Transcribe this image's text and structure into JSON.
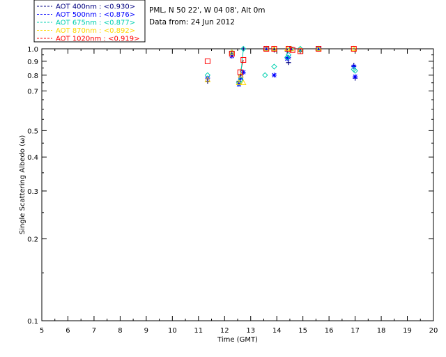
{
  "header": {
    "site": "PML, N 50 22', W 04 08', Alt 0m",
    "date_line": "Data from: 24 Jun 2012"
  },
  "chart_data": {
    "type": "scatter",
    "xlabel": "Time (GMT)",
    "ylabel": "Single Scattering Albedo (ω)",
    "xlim": [
      5,
      20
    ],
    "ylim": [
      0.1,
      1.0
    ],
    "yscale": "log",
    "xticks": [
      "5",
      "6",
      "7",
      "8",
      "9",
      "10",
      "11",
      "12",
      "13",
      "14",
      "15",
      "16",
      "17",
      "18",
      "19",
      "20"
    ],
    "yticks": [
      {
        "value": 1.0,
        "label": "1.0"
      },
      {
        "value": 0.9,
        "label": "0.9"
      },
      {
        "value": 0.8,
        "label": "0.8"
      },
      {
        "value": 0.7,
        "label": "0.7"
      },
      {
        "value": 0.5,
        "label": "0.5"
      },
      {
        "value": 0.4,
        "label": "0.4"
      },
      {
        "value": 0.3,
        "label": "0.3"
      },
      {
        "value": 0.2,
        "label": "0.2"
      },
      {
        "value": 0.1,
        "label": "0.1"
      }
    ],
    "legend_placement": "top-left",
    "series": [
      {
        "name": "AOT  400nm : <0.930>",
        "color": "#000080",
        "marker": "plus",
        "x": [
          11.35,
          12.28,
          12.55,
          12.62,
          12.72,
          13.6,
          13.9,
          14.4,
          14.45,
          14.55,
          14.9,
          15.6,
          16.95,
          17.0
        ],
        "y": [
          0.76,
          0.96,
          0.76,
          0.8,
          1.0,
          1.0,
          0.99,
          0.98,
          0.89,
          1.0,
          0.98,
          1.0,
          0.87,
          0.78
        ]
      },
      {
        "name": "AOT  500nm : <0.876>",
        "color": "#0000ff",
        "marker": "star",
        "x": [
          11.35,
          12.28,
          12.55,
          12.62,
          12.72,
          13.6,
          13.9,
          14.4,
          14.45,
          14.55,
          14.9,
          15.6,
          16.95,
          17.0
        ],
        "y": [
          0.78,
          0.94,
          0.74,
          0.78,
          0.82,
          1.0,
          0.8,
          0.92,
          0.93,
          1.0,
          0.99,
          1.0,
          0.86,
          0.79
        ]
      },
      {
        "name": "AOT  675nm : <0.877>",
        "color": "#00d0b0",
        "marker": "diamond",
        "x": [
          11.35,
          12.28,
          12.55,
          12.62,
          12.72,
          13.55,
          13.9,
          14.4,
          14.45,
          14.55,
          14.9,
          15.6,
          16.95,
          17.0
        ],
        "y": [
          0.8,
          0.97,
          0.75,
          0.77,
          1.0,
          0.8,
          0.86,
          0.93,
          0.95,
          1.0,
          1.0,
          1.0,
          0.84,
          0.83
        ]
      },
      {
        "name": "AOT  870nm : <0.892>",
        "color": "#ffd700",
        "marker": "triangle",
        "x": [
          11.35,
          12.28,
          12.55,
          12.62,
          12.72,
          13.6,
          13.9,
          14.4,
          14.55,
          14.9,
          15.6,
          16.95
        ],
        "y": [
          0.77,
          0.97,
          0.75,
          0.8,
          0.75,
          1.0,
          1.0,
          1.0,
          1.0,
          0.99,
          1.0,
          1.0
        ]
      },
      {
        "name": "AOT 1020nm : <0.919>",
        "color": "#ff0000",
        "marker": "square",
        "x": [
          11.35,
          12.28,
          12.6,
          12.72,
          13.6,
          13.9,
          14.45,
          14.6,
          14.9,
          15.6,
          16.95
        ],
        "y": [
          0.9,
          0.96,
          0.82,
          0.91,
          1.0,
          1.0,
          1.0,
          0.99,
          0.98,
          1.0,
          1.0
        ]
      }
    ],
    "connected_segments": [
      {
        "color": "#ff0000",
        "x": [
          12.6,
          12.72
        ],
        "y": [
          0.82,
          0.91
        ]
      },
      {
        "color": "#00d0b0",
        "x": [
          12.6,
          12.72
        ],
        "y": [
          0.77,
          1.0
        ]
      },
      {
        "color": "#ffd700",
        "x": [
          12.55,
          12.62
        ],
        "y": [
          0.75,
          0.8
        ]
      }
    ]
  }
}
